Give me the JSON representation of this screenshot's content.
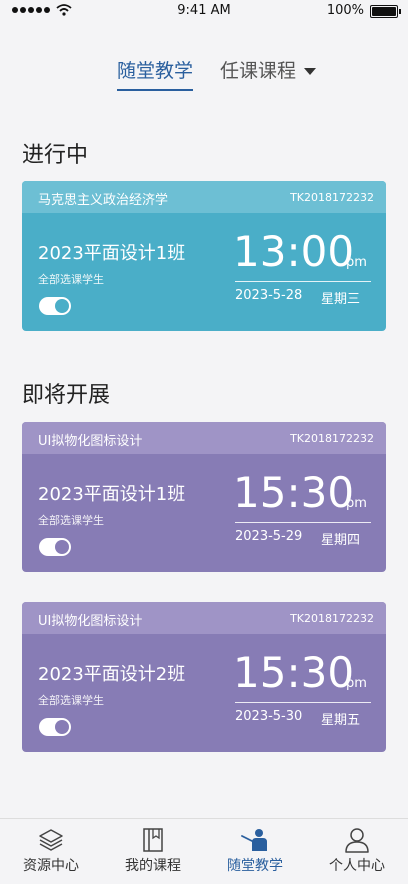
{
  "status_bar": {
    "time": "9:41 AM",
    "battery": "100%"
  },
  "top_tabs": [
    {
      "label": "随堂教学",
      "active": true
    },
    {
      "label": "任课课程",
      "active": false
    }
  ],
  "sections": {
    "ongoing": "进行中",
    "upcoming": "即将开展"
  },
  "cards": [
    {
      "course": "马克思主义政治经济学",
      "code": "TK2018172232",
      "class_name": "2023平面设计1班",
      "sub_label": "全部选课学生",
      "time": "13:00",
      "period": "pm",
      "date": "2023-5-28",
      "weekday": "星期三",
      "color": "#4aaec8",
      "toggle_on": true
    },
    {
      "course": "UI拟物化图标设计",
      "code": "TK2018172232",
      "class_name": "2023平面设计1班",
      "sub_label": "全部选课学生",
      "time": "15:30",
      "period": "pm",
      "date": "2023-5-29",
      "weekday": "星期四",
      "color": "#877cb5",
      "toggle_on": true
    },
    {
      "course": "UI拟物化图标设计",
      "code": "TK2018172232",
      "class_name": "2023平面设计2班",
      "sub_label": "全部选课学生",
      "time": "15:30",
      "period": "pm",
      "date": "2023-5-30",
      "weekday": "星期五",
      "color": "#877cb5",
      "toggle_on": true
    }
  ],
  "bottom_nav": [
    {
      "label": "资源中心",
      "icon": "layers-icon"
    },
    {
      "label": "我的课程",
      "icon": "book-icon"
    },
    {
      "label": "随堂教学",
      "icon": "teacher-icon",
      "active": true
    },
    {
      "label": "个人中心",
      "icon": "user-icon"
    }
  ],
  "colors": {
    "accent": "#2a5f9e",
    "teal": "#4aaec8",
    "purple": "#877cb5"
  }
}
